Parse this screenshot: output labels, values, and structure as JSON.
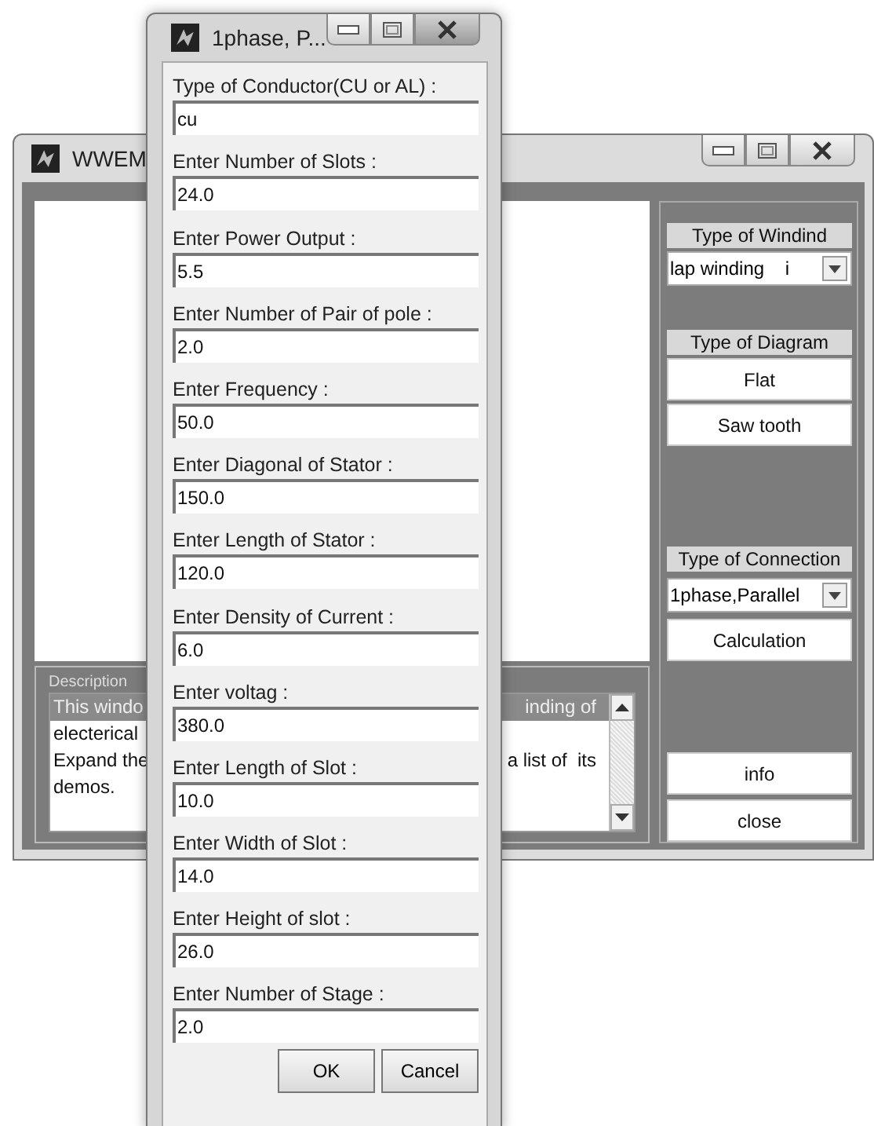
{
  "main_window": {
    "title": "WWEM",
    "panel": {
      "winding": {
        "label": "Type of  Windind",
        "value": "lap winding    i"
      },
      "diagram": {
        "label": "Type of  Diagram",
        "buttons": [
          "Flat",
          "Saw tooth"
        ]
      },
      "connection": {
        "label": "Type of  Connection",
        "value": "1phase,Parallel"
      },
      "calculation": "Calculation",
      "info": "info",
      "close": "close"
    },
    "description": {
      "title": "Description",
      "lines": [
        {
          "left": "This windo",
          "right": "inding of",
          "selected": true
        },
        {
          "left": "electerical",
          "selected": false
        },
        {
          "left": "Expand the",
          "right": "a list of  its",
          "selected": false
        },
        {
          "left": "demos.",
          "selected": false
        }
      ]
    }
  },
  "dialog": {
    "title": "1phase, P...",
    "fields": [
      {
        "label": "Type of Conductor(CU or AL) :",
        "value": "cu"
      },
      {
        "label": "Enter Number of Slots :",
        "value": "24.0"
      },
      {
        "label": "Enter Power Output :",
        "value": "5.5"
      },
      {
        "label": "Enter Number of Pair of pole :",
        "value": "2.0"
      },
      {
        "label": "Enter Frequency :",
        "value": "50.0"
      },
      {
        "label": "Enter Diagonal of Stator :",
        "value": "150.0"
      },
      {
        "label": "Enter Length of Stator :",
        "value": "120.0"
      },
      {
        "label": "Enter Density of Current :",
        "value": "6.0"
      },
      {
        "label": "Enter voltag :",
        "value": "380.0"
      },
      {
        "label": "Enter Length of Slot :",
        "value": "10.0"
      },
      {
        "label": "Enter Width of Slot :",
        "value": "14.0"
      },
      {
        "label": "Enter Height of slot :",
        "value": "26.0"
      },
      {
        "label": "Enter Number of Stage :",
        "value": "2.0"
      }
    ],
    "buttons": [
      "OK",
      "Cancel"
    ]
  }
}
